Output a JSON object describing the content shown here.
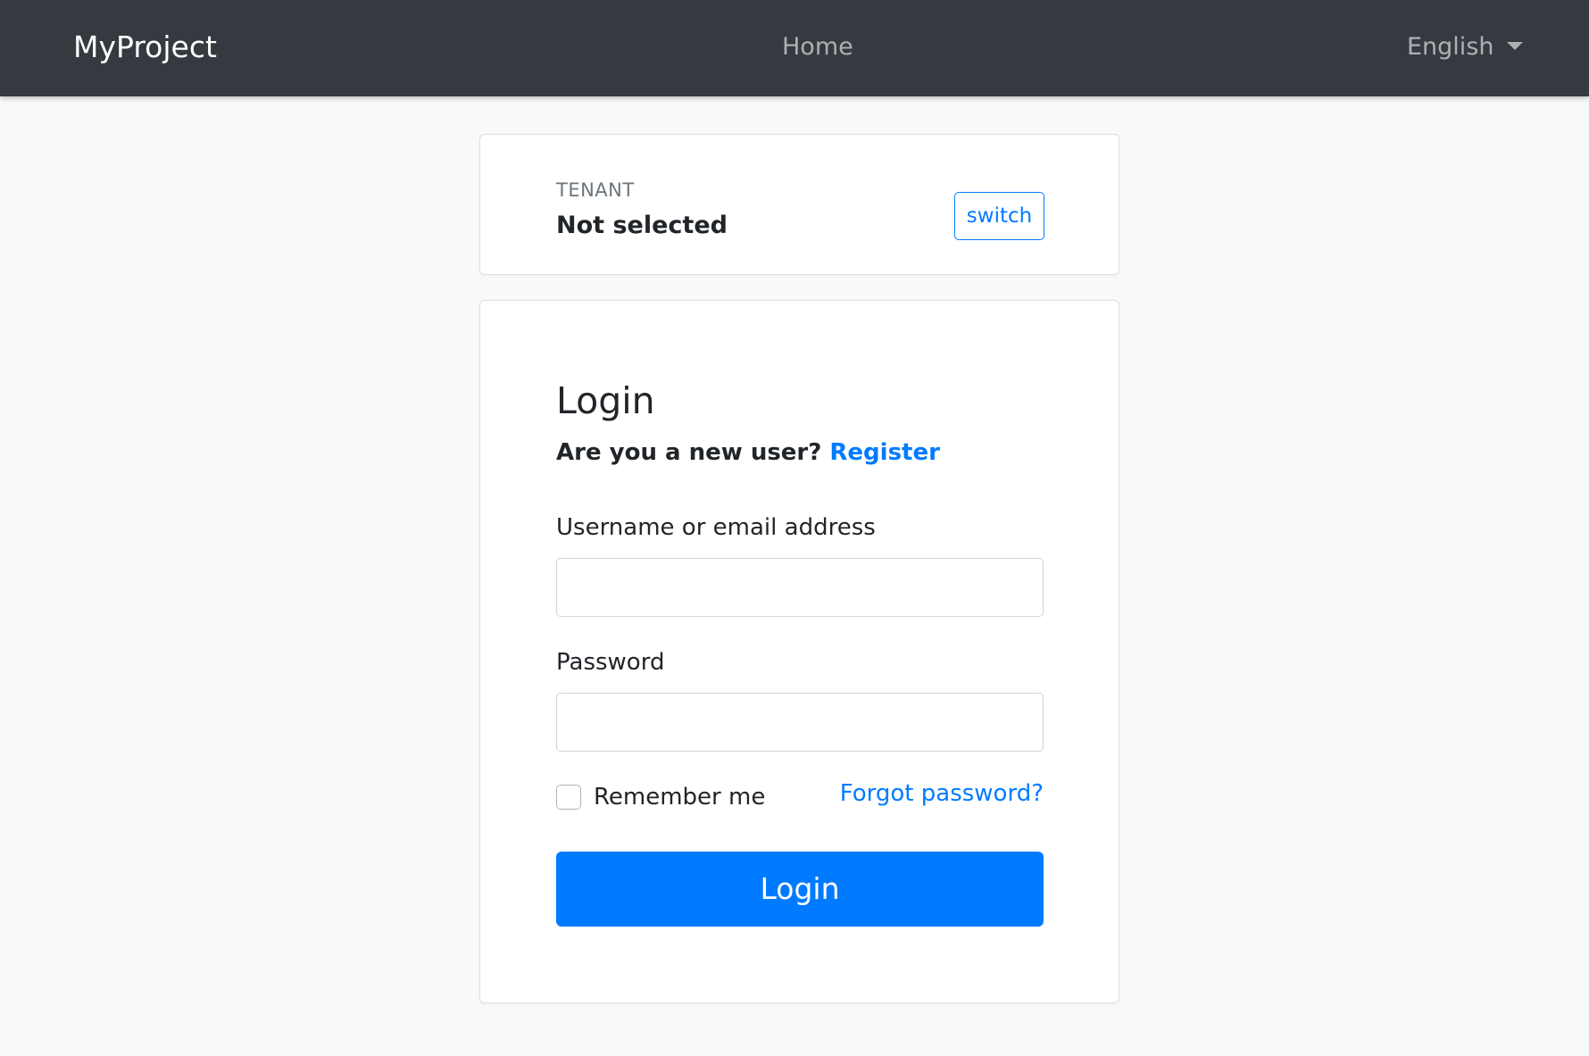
{
  "navbar": {
    "brand": "MyProject",
    "home_label": "Home",
    "language_label": "English"
  },
  "tenant": {
    "label": "TENANT",
    "value": "Not selected",
    "switch_label": "switch"
  },
  "login": {
    "title": "Login",
    "new_user_prompt": "Are you a new user?",
    "register_label": "Register",
    "username_label": "Username or email address",
    "username_value": "",
    "password_label": "Password",
    "password_value": "",
    "remember_label": "Remember me",
    "remember_checked": false,
    "forgot_label": "Forgot password?",
    "submit_label": "Login"
  },
  "colors": {
    "navbar_bg": "#343a40",
    "page_bg": "#f8f9fa",
    "primary": "#007bff",
    "text": "#212529",
    "muted": "#6c757d"
  },
  "icons": {
    "language_dropdown": "caret-down-icon"
  }
}
